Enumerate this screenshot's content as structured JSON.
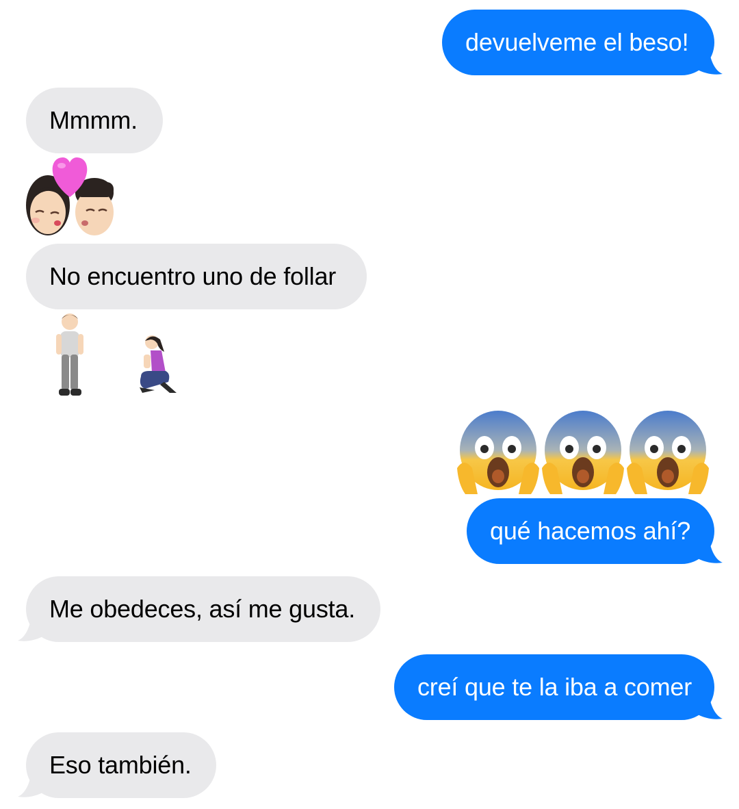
{
  "messages": [
    {
      "direction": "outgoing",
      "text": "devuelveme el beso!"
    },
    {
      "direction": "incoming",
      "text": "Mmmm."
    },
    {
      "direction": "incoming",
      "emoji": "couple-kiss-emoji"
    },
    {
      "direction": "incoming",
      "text": "No encuentro uno de follar"
    },
    {
      "direction": "incoming",
      "emoji": [
        "person-standing-emoji",
        "woman-kneeling-emoji"
      ]
    },
    {
      "direction": "outgoing",
      "emoji": [
        "face-screaming-emoji",
        "face-screaming-emoji",
        "face-screaming-emoji"
      ]
    },
    {
      "direction": "outgoing",
      "text": "qué hacemos ahí?"
    },
    {
      "direction": "incoming",
      "text": "Me obedeces, así me gusta."
    },
    {
      "direction": "outgoing",
      "text": "creí que te la iba a comer"
    },
    {
      "direction": "incoming",
      "text": "Eso también."
    }
  ],
  "colors": {
    "outgoing_bubble": "#0a7cff",
    "incoming_bubble": "#e9e9eb",
    "outgoing_text": "#ffffff",
    "incoming_text": "#000000",
    "background": "#ffffff"
  }
}
